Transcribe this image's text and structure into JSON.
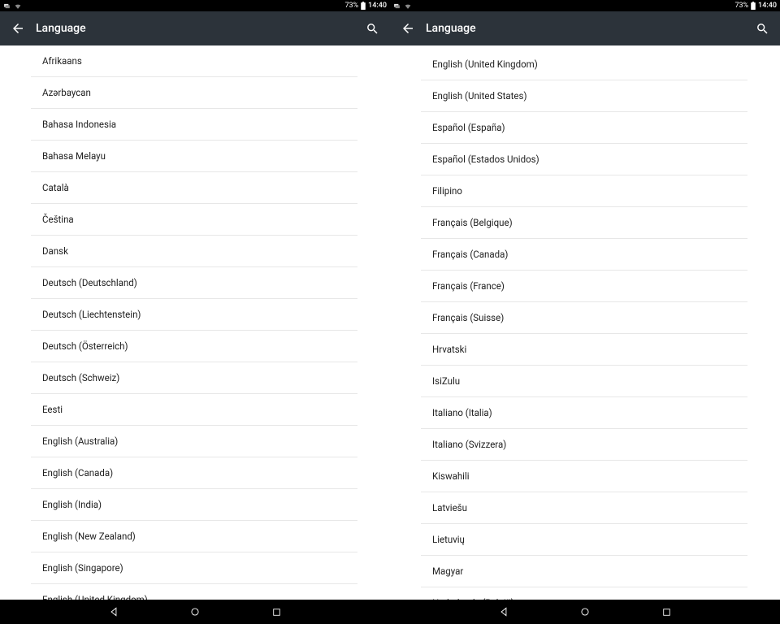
{
  "status": {
    "battery_pct": "73%",
    "time": "14:40"
  },
  "appbar": {
    "title": "Language"
  },
  "left_list": [
    "Afrikaans",
    "Azərbaycan",
    "Bahasa Indonesia",
    "Bahasa Melayu",
    "Català",
    "Čeština",
    "Dansk",
    "Deutsch (Deutschland)",
    "Deutsch (Liechtenstein)",
    "Deutsch (Österreich)",
    "Deutsch (Schweiz)",
    "Eesti",
    "English (Australia)",
    "English (Canada)",
    "English (India)",
    "English (New Zealand)",
    "English (Singapore)",
    "English (United Kingdom)"
  ],
  "right_list": [
    "English (United Kingdom)",
    "English (United States)",
    "Español (España)",
    "Español (Estados Unidos)",
    "Filipino",
    "Français (Belgique)",
    "Français (Canada)",
    "Français (France)",
    "Français (Suisse)",
    "Hrvatski",
    "IsiZulu",
    "Italiano (Italia)",
    "Italiano (Svizzera)",
    "Kiswahili",
    "Latviešu",
    "Lietuvių",
    "Magyar",
    "Nederlands (België)"
  ]
}
